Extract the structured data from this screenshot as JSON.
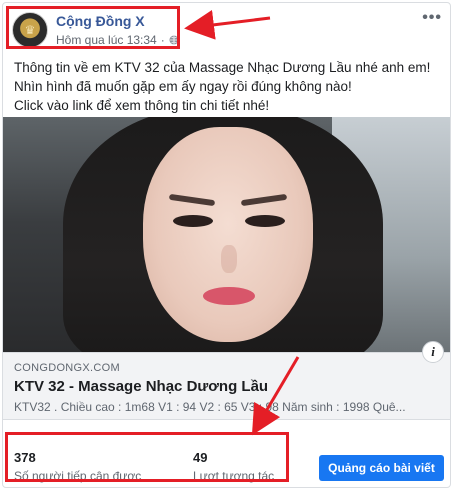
{
  "post": {
    "page_name": "Cộng Đồng X",
    "timestamp": "Hôm qua lúc 13:34",
    "privacy_icon": "globe-icon",
    "more_icon": "more-options-icon",
    "text_lines": [
      "Thông tin về em KTV 32 của Massage Nhạc Dương Lầu nhé anh em!",
      "Nhìn hình đã muốn gặp em ấy ngay rồi đúng không nào!",
      "Click vào link để xem thông tin chi tiết nhé!"
    ]
  },
  "link_preview": {
    "domain": "CONGDONGX.COM",
    "title": "KTV 32 - Massage Nhạc Dương Lầu",
    "description": "KTV32 . Chiều cao : 1m68 V1 : 94 V2 : 65 V3 : 98 Năm sinh : 1998 Quê...",
    "info_icon": "i"
  },
  "stats": {
    "reach_value": "378",
    "reach_label": "Số người tiếp cận được",
    "engagement_value": "49",
    "engagement_label": "Lượt tương tác",
    "boost_label": "Quảng cáo bài viết"
  },
  "colors": {
    "link_blue": "#385898",
    "button_blue": "#1877f2",
    "highlight_red": "#e41e26"
  }
}
